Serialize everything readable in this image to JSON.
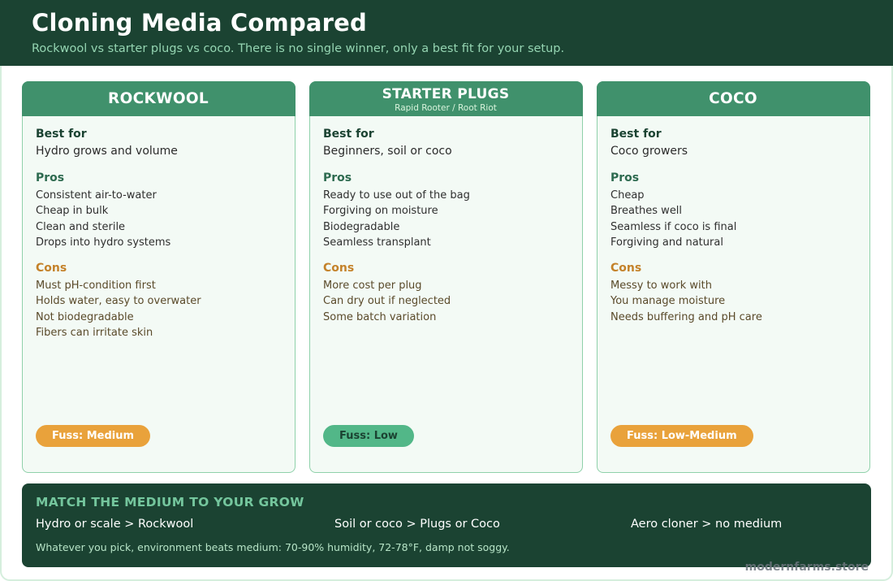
{
  "header": {
    "title": "Cloning Media Compared",
    "subtitle": "Rockwool vs starter plugs vs coco. There is no single winner, only a best fit for your setup."
  },
  "labels": {
    "best_for": "Best for",
    "pros": "Pros",
    "cons": "Cons"
  },
  "cards": [
    {
      "title": "ROCKWOOL",
      "subtitle": "",
      "best_for": "Hydro grows and volume",
      "pros": [
        "Consistent air-to-water",
        "Cheap in bulk",
        "Clean and sterile",
        "Drops into hydro systems"
      ],
      "cons": [
        "Must pH-condition first",
        "Holds water, easy to overwater",
        "Not biodegradable",
        "Fibers can irritate skin"
      ],
      "fuss": "Fuss: Medium",
      "fuss_color": "#e9a23b"
    },
    {
      "title": "STARTER PLUGS",
      "subtitle": "Rapid Rooter / Root Riot",
      "best_for": "Beginners, soil or coco",
      "pros": [
        "Ready to use out of the bag",
        "Forgiving on moisture",
        "Biodegradable",
        "Seamless transplant"
      ],
      "cons": [
        "More cost per plug",
        "Can dry out if neglected",
        "Some batch variation"
      ],
      "fuss": "Fuss: Low",
      "fuss_color": "#52b788"
    },
    {
      "title": "COCO",
      "subtitle": "",
      "best_for": "Coco growers",
      "pros": [
        "Cheap",
        "Breathes well",
        "Seamless if coco is final",
        "Forgiving and natural"
      ],
      "cons": [
        "Messy to work with",
        "You manage moisture",
        "Needs buffering and pH care"
      ],
      "fuss": "Fuss: Low-Medium",
      "fuss_color": "#e9a23b"
    }
  ],
  "footer": {
    "title": "MATCH THE MEDIUM TO YOUR GROW",
    "matches": [
      "Hydro or scale > Rockwool",
      "Soil or coco > Plugs or Coco",
      "Aero cloner > no medium"
    ],
    "note": "Whatever you pick, environment beats medium: 70-90% humidity, 72-78°F, damp not soggy."
  },
  "brand": "modernfarms.store",
  "colors": {
    "header_bg": "#1b4332",
    "card_head": "#40916c",
    "pros_title": "#2d6a4f",
    "cons_title": "#c4822a"
  }
}
